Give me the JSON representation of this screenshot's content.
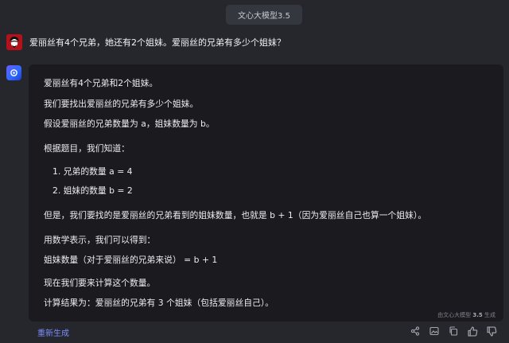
{
  "header": {
    "model_label": "文心大模型3.5"
  },
  "question": {
    "text": "爱丽丝有4个兄弟，她还有2个姐妹。爱丽丝的兄弟有多少个姐妹？"
  },
  "answer": {
    "lines": [
      "爱丽丝有4个兄弟和2个姐妹。",
      "我们要找出爱丽丝的兄弟有多少个姐妹。",
      "假设爱丽丝的兄弟数量为 a，姐妹数量为 b。",
      "根据题目，我们知道：",
      "1. 兄弟的数量 a = 4",
      "2. 姐妹的数量 b = 2",
      "但是，我们要找的是爱丽丝的兄弟看到的姐妹数量，也就是 b + 1（因为爱丽丝自己也算一个姐妹）。",
      "用数学表示，我们可以得到：",
      "姐妹数量（对于爱丽丝的兄弟来说） = b + 1",
      "现在我们要来计算这个数量。",
      "计算结果为：爱丽丝的兄弟有 3 个姐妹（包括爱丽丝自己）。"
    ],
    "footnote_prefix": "由文心大模型",
    "footnote_version": "3.5",
    "footnote_suffix": "生成"
  },
  "toolbar": {
    "regenerate_label": "重新生成",
    "icons": [
      "share-icon",
      "image-icon",
      "copy-icon",
      "thumbs-up-icon",
      "thumbs-down-icon"
    ]
  },
  "colors": {
    "background": "#26272d",
    "card": "#1b1b1f",
    "accent": "#7b8cff"
  }
}
